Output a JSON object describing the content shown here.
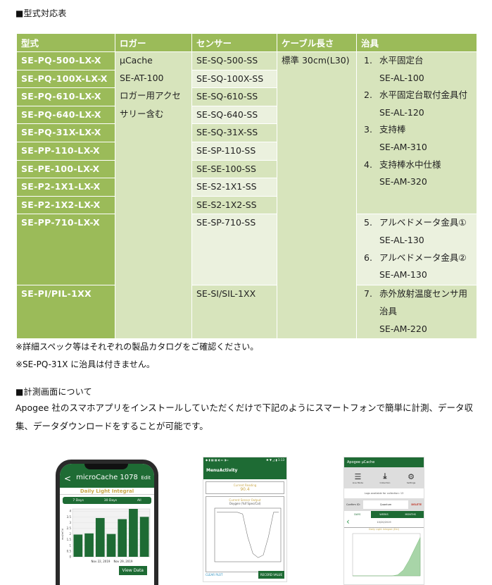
{
  "section1": {
    "heading": "■型式対応表"
  },
  "table": {
    "headers": [
      "型式",
      "ロガー",
      "センサー",
      "ケーブル長さ",
      "治具"
    ],
    "models": [
      "SE-PQ-500-LX-X",
      "SE-PQ-100X-LX-X",
      "SE-PQ-610-LX-X",
      "SE-PQ-640-LX-X",
      "SE-PQ-31X-LX-X",
      "SE-PP-110-LX-X",
      "SE-PE-100-LX-X",
      "SE-P2-1X1-LX-X",
      "SE-P2-1X2-LX-X",
      "SE-PP-710-LX-X",
      "SE-PI/PIL-1XX"
    ],
    "logger": [
      "μCache",
      "SE-AT-100",
      "ロガー用アクセ",
      "サリー含む"
    ],
    "sensors": [
      "SE-SQ-500-SS",
      "SE-SQ-100X-SS",
      "SE-SQ-610-SS",
      "SE-SQ-640-SS",
      "SE-SQ-31X-SS",
      "SE-SP-110-SS",
      "SE-SE-100-SS",
      "SE-S2-1X1-SS",
      "SE-S2-1X2-SS",
      "SE-SP-710-SS",
      "SE-SI/SIL-1XX"
    ],
    "cable": "標準 30cm(L30)",
    "jigs": [
      {
        "num": "1.",
        "name": "水平固定台",
        "code": "SE-AL-100"
      },
      {
        "num": "2.",
        "name": "水平固定台取付金具付",
        "code": "SE-AL-120"
      },
      {
        "num": "3.",
        "name": "支持棒",
        "code": "SE-AM-310"
      },
      {
        "num": "4.",
        "name": "支持棒水中仕様",
        "code": "SE-AM-320"
      },
      {
        "num": "5.",
        "name": "アルベドメータ金具①",
        "code": "SE-AL-130"
      },
      {
        "num": "6.",
        "name": "アルベドメータ金具②",
        "code": "SE-AM-130"
      },
      {
        "num": "7.",
        "name": "赤外放射温度センサ用",
        "name2": "治具",
        "code": "SE-AM-220"
      }
    ]
  },
  "notes": [
    "※詳細スペック等はそれぞれの製品カタログをご確認ください。",
    "※SE-PQ-31X に治具は付きません。"
  ],
  "section2": {
    "heading": "■計測画面について",
    "paragraph": "Apogee 社のスマホアプリをインストールしていただくだけで下記のようにスマートフォンで簡単に計測、データ収集、データダウンロードをすることが可能です。"
  },
  "screens": {
    "phone1": {
      "title": "microCache 1078",
      "back": "<",
      "edit": "Edit",
      "subtitle": "Daily Light Integral",
      "segments": [
        "7 Days",
        "30 Days",
        "All"
      ],
      "x_labels": [
        "Nov 22, 2019",
        "Nov 29, 2019"
      ],
      "y_label": "mol/m²/d",
      "view_data": "View Data",
      "chart_data": {
        "type": "bar",
        "title": "Daily Light Integral",
        "ylabel": "mol/m²/d",
        "ylim": [
          0,
          4.2
        ],
        "y_ticks": [
          "0",
          "0.5",
          "1",
          "1.5",
          "2",
          "2.5",
          "3",
          "3.5",
          "4"
        ],
        "values": [
          1.95,
          2.05,
          3.4,
          2.0,
          3.3,
          4.2,
          3.5
        ]
      }
    },
    "phone2": {
      "status_left": "◆ ▮ ▦ ▦ ◐ ▸ ◑ ▹",
      "status_right": "✱ ▼ ◿ ▮ 1:13",
      "title": "MenuActivity",
      "reading_label": "Current Reading",
      "reading_value": "90.4",
      "plot_label": "Current Sensor Output",
      "plot_title": "Oxygen (%if Spec/Cal)",
      "clear_plot": "CLEAR PLOT",
      "record": "RECORD VALUE",
      "chart_data": {
        "type": "line",
        "values": [
          90,
          90,
          90,
          90,
          90,
          88,
          60,
          40,
          35,
          38,
          60,
          90,
          90
        ]
      }
    },
    "phone3": {
      "title": "Apogee μCache",
      "tools": [
        "Live Mode",
        "Collection",
        "Settings"
      ],
      "logs_text": "Logs available for collection: 13",
      "config_label": "Confirm ID:",
      "config_value": "Quantum",
      "delete": "DELETE",
      "tabs": [
        "DAYS",
        "WEEKS",
        "MONTHS"
      ],
      "date": "10/20/2019",
      "chart_title": "Daily Light Integral (DLI)",
      "chart_data": {
        "type": "area",
        "values": [
          0,
          0,
          0,
          0,
          0,
          0,
          0,
          0,
          5,
          30,
          80,
          140,
          200
        ]
      }
    }
  }
}
